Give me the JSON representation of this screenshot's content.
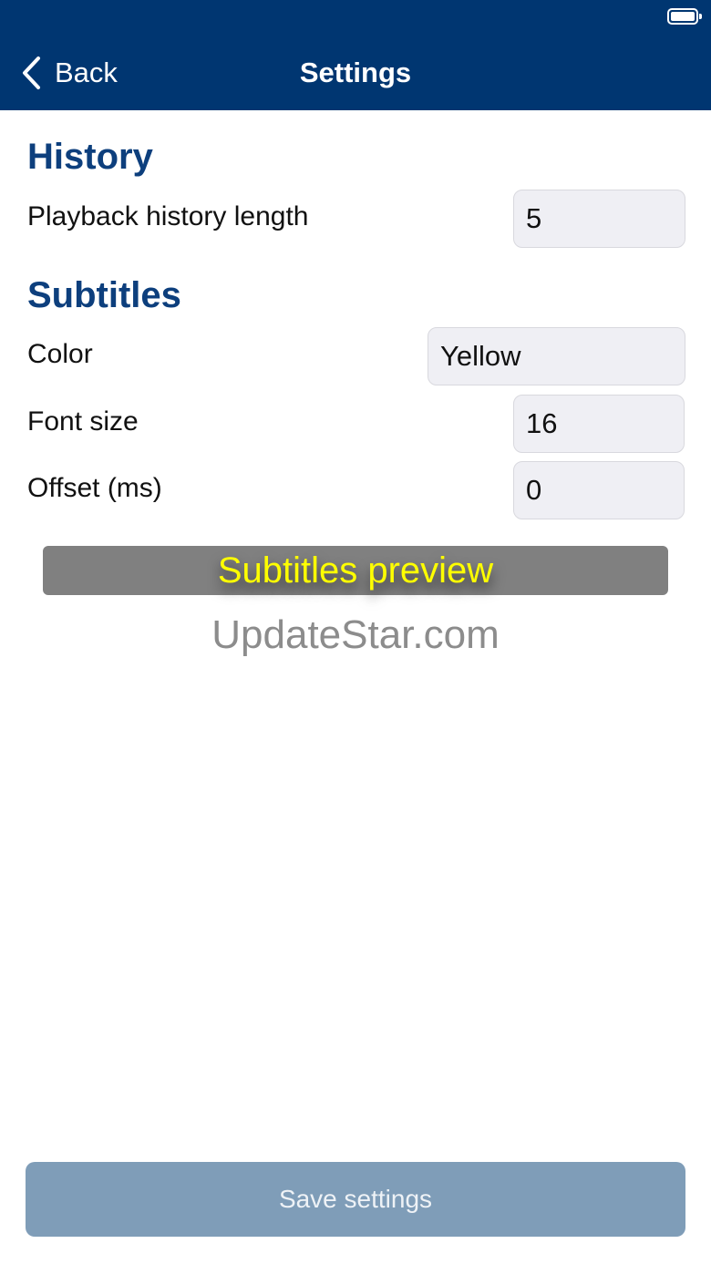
{
  "nav": {
    "back_label": "Back",
    "title": "Settings"
  },
  "history": {
    "section_title": "History",
    "playback_length_label": "Playback history length",
    "playback_length_value": "5"
  },
  "subtitles": {
    "section_title": "Subtitles",
    "color_label": "Color",
    "color_value": "Yellow",
    "font_size_label": "Font size",
    "font_size_value": "16",
    "offset_label": "Offset (ms)",
    "offset_value": "0",
    "preview_text": "Subtitles preview"
  },
  "watermark": "UpdateStar.com",
  "save_label": "Save settings",
  "colors": {
    "header_bg": "#003671",
    "section_title": "#0d3f7d",
    "field_bg": "#efeff4",
    "preview_bg": "#808080",
    "preview_text": "#ffff00",
    "save_button_bg": "#7f9db8"
  },
  "icons": {
    "back": "chevron-left-icon",
    "battery": "battery-icon"
  }
}
